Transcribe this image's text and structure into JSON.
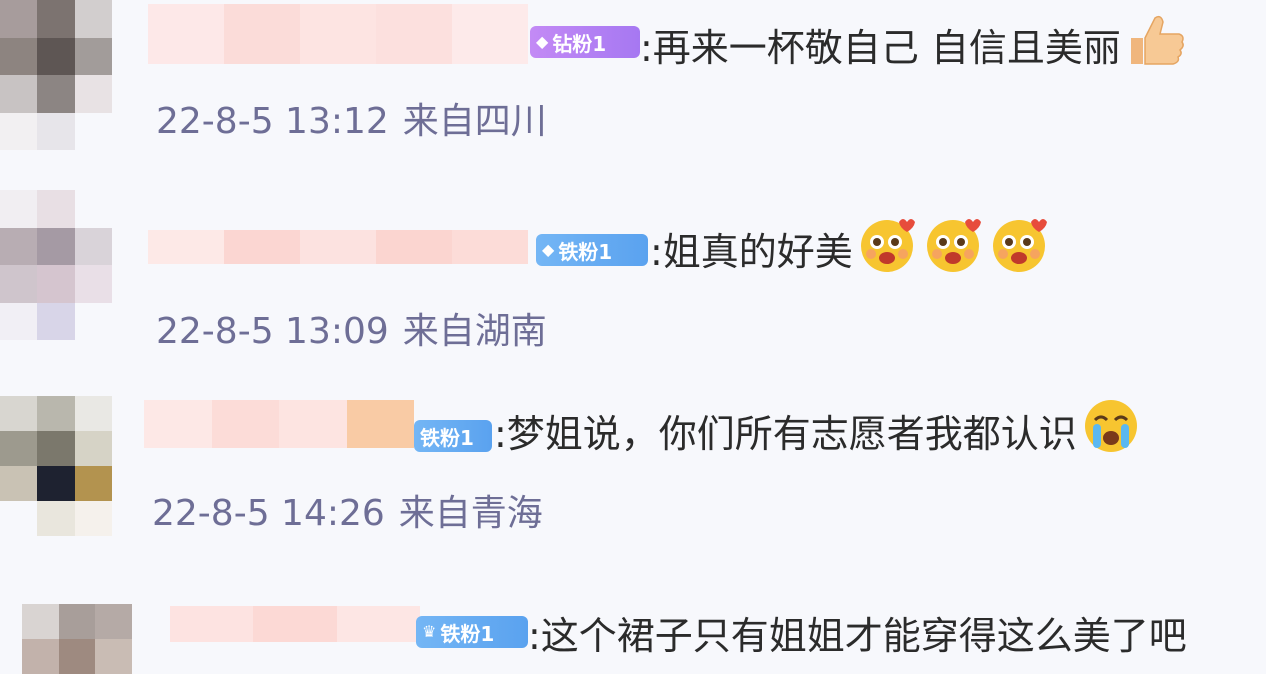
{
  "comments": [
    {
      "badge_label": "钻粉1",
      "badge_icon": "diamond-icon",
      "badge_color": "#b07ff3",
      "text": ":再来一杯敬自己  自信且美丽",
      "emojis": [
        "thumbs-up-icon"
      ],
      "timestamp": "22-8-5 13:12",
      "location": "来自四川"
    },
    {
      "badge_label": "铁粉1",
      "badge_icon": "diamond-icon",
      "badge_color": "#64a9f2",
      "text": ":姐真的好美",
      "emojis": [
        "heart-eyes-icon",
        "heart-eyes-icon",
        "heart-eyes-icon"
      ],
      "timestamp": "22-8-5 13:09",
      "location": "来自湖南"
    },
    {
      "badge_label": "铁粉1",
      "badge_icon": "fan-icon",
      "badge_color": "#64a9f2",
      "text": ":梦姐说，你们所有志愿者我都认识",
      "emojis": [
        "crying-face-icon"
      ],
      "timestamp": "22-8-5 14:26",
      "location": "来自青海"
    },
    {
      "badge_label": "铁粉1",
      "badge_icon": "fan-icon",
      "badge_color": "#64a9f2",
      "text": ":这个裙子只有姐姐才能穿得这么美了吧",
      "emojis": [],
      "timestamp": "",
      "location": ""
    }
  ]
}
